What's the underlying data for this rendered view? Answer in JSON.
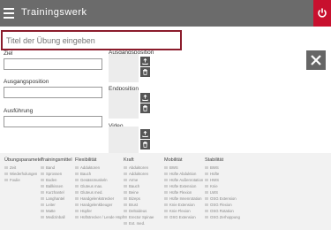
{
  "header": {
    "brand": "Trainingswerk"
  },
  "form": {
    "title_placeholder": "Titel der Übung eingeben",
    "ziel_label": "Ziel",
    "ausgangsposition_label": "Ausgangsposition",
    "ausfuehrung_label": "Ausführung"
  },
  "media": {
    "start_label": "Ausgangsposition",
    "end_label": "Endposition",
    "video_label": "Video"
  },
  "categories": [
    {
      "heading": "Übungsparameter",
      "items": [
        "Zeit",
        "Wiederholungen",
        "Foulie"
      ]
    },
    {
      "heading": "Trainingsmittel",
      "items": [
        "Band",
        "Sprossen",
        "Boden",
        "Ballkissen",
        "Kurzhantel",
        "Langhantel",
        "Leiter",
        "Matte",
        "Medizinball"
      ]
    },
    {
      "heading": "Flexibilität",
      "items": [
        "Adduktoren",
        "Bauch",
        "Gesässmuskeln",
        "Gluteus max.",
        "Gluteus med.",
        "Handgelenkstrecker",
        "Handgelenkbeuger",
        "Hüpfer",
        "Hüftstrecker / Lende Hüpfer"
      ]
    },
    {
      "heading": "Kraft",
      "items": [
        "Abduktoren",
        "Adduktoren",
        "Arme",
        "Bauch",
        "Beine",
        "Bizeps",
        "Brust",
        "Deltoideus",
        "Erector Spinae",
        "Ext. med."
      ]
    },
    {
      "heading": "Mobilität",
      "items": [
        "BWS",
        "Hüfte Abduktion",
        "Hüfte Außenrotation",
        "Hüfte Extension",
        "Hüfte Flexion",
        "Hüfte Innenrotation",
        "Knie Extension",
        "Knie Flexion",
        "OSG Extension"
      ]
    },
    {
      "heading": "Stabilität",
      "items": [
        "BWS",
        "Hüfte",
        "HWS",
        "Knie",
        "LWS",
        "OSG Extension",
        "OSG Flexion",
        "OSG Rotation",
        "OSG Zerhoppung"
      ]
    }
  ]
}
